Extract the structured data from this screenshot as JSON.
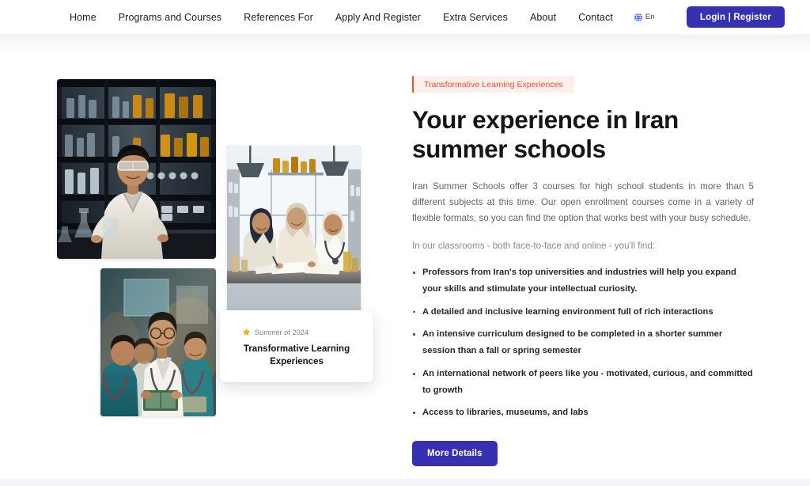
{
  "header": {
    "nav_items": [
      {
        "label": "Home"
      },
      {
        "label": "Programs and Courses"
      },
      {
        "label": "References For"
      },
      {
        "label": "Apply And Register"
      },
      {
        "label": "Extra Services"
      },
      {
        "label": "About"
      },
      {
        "label": "Contact"
      }
    ],
    "language": {
      "icon": "globe-icon",
      "label": "En",
      "color": "#2b5ae8"
    },
    "login_label": "Login | Register",
    "login_color": "#3730b0"
  },
  "gallery": {
    "photos": [
      {
        "name": "student-in-chemistry-lab",
        "alt": "Student in white lab coat holding a flask in a dark laboratory with shelves of amber bottles"
      },
      {
        "name": "women-students-studying",
        "alt": "Three women students in hijabs studying together at a bright laboratory table"
      },
      {
        "name": "medical-students-group",
        "alt": "Group of medical students in teal scrubs and white coats reading a book"
      }
    ],
    "card": {
      "icon": "star-icon",
      "star_color": "#f5a623",
      "tag": "Summer of 2024",
      "title": "Transformative Learning Experiences"
    }
  },
  "content": {
    "badge": {
      "label": "Transformative Learning Experiences",
      "accent": "#f0502a",
      "background": "#fdf0ec"
    },
    "headline": "Your experience in Iran summer schools",
    "intro_paragraph": "Iran Summer Schools offer 3 courses for high school students in more than 5 different subjects at this time. Our open enrollment courses come in a variety of flexible formats, so you can find the option that works best with your busy schedule.",
    "lead_line": "In our classrooms - both face-to-face and online - you'll find:",
    "bullets": [
      "Professors from Iran's top universities and industries will help you expand your skills and stimulate your intellectual curiosity.",
      "A detailed and inclusive learning environment full of rich interactions",
      "An intensive curriculum designed to be completed in a shorter summer session than a fall or spring semester",
      "An international network of peers like you - motivated, curious, and committed to growth",
      "Access to libraries, museums, and labs"
    ],
    "cta_label": "More Details"
  }
}
